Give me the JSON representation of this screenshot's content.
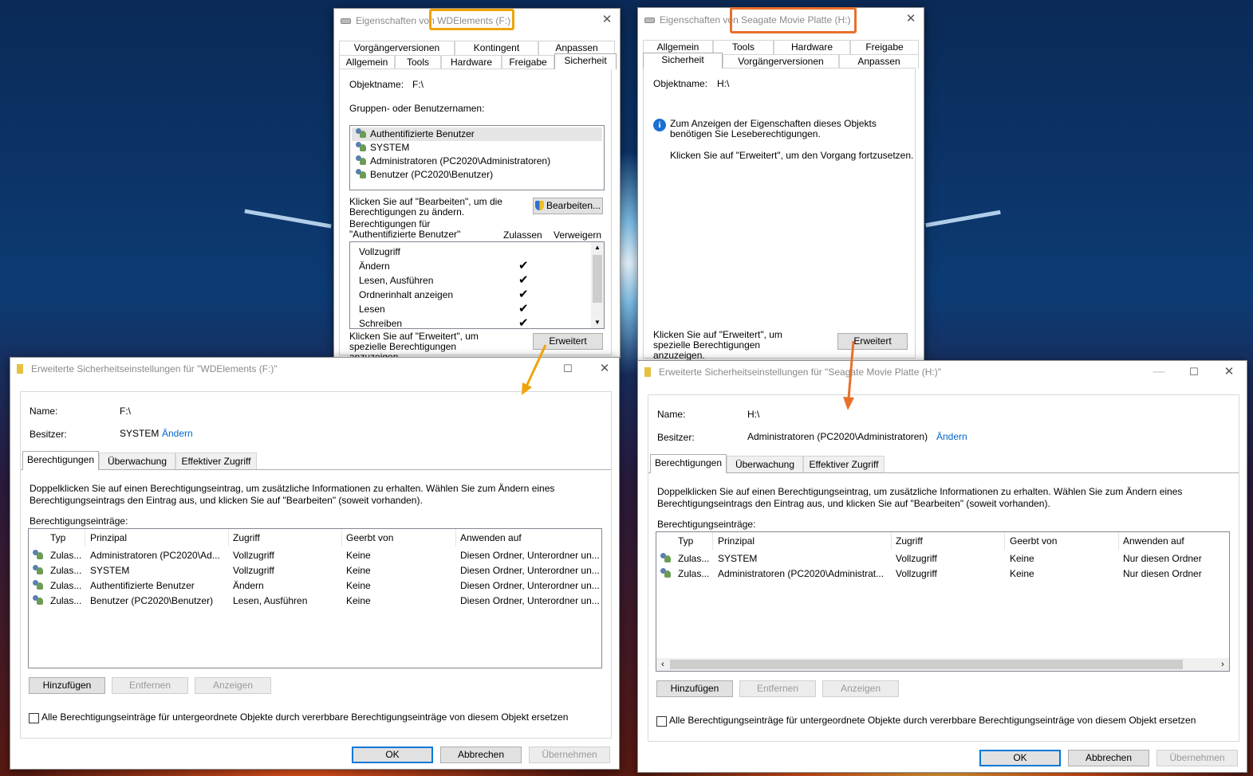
{
  "colors": {
    "highlight_left": "#f0a30a",
    "highlight_right": "#e8702a",
    "link": "#0066cc",
    "focus": "#0078d7"
  },
  "props_left": {
    "title": "Eigenschaften von WDElements (F:)",
    "tabs_row1": [
      "Vorgängerversionen",
      "Kontingent",
      "Anpassen"
    ],
    "tabs_row2": [
      "Allgemein",
      "Tools",
      "Hardware",
      "Freigabe",
      "Sicherheit"
    ],
    "object_label": "Objektname:",
    "object_value": "F:\\",
    "groups_label": "Gruppen- oder Benutzernamen:",
    "groups": [
      "Authentifizierte Benutzer",
      "SYSTEM",
      "Administratoren (PC2020\\Administratoren)",
      "Benutzer (PC2020\\Benutzer)"
    ],
    "edit_hint": "Klicken Sie auf \"Bearbeiten\", um die Berechtigungen zu ändern.",
    "edit_button": "Bearbeiten...",
    "perm_for": "Berechtigungen für \"Authentifizierte Benutzer\"",
    "col_allow": "Zulassen",
    "col_deny": "Verweigern",
    "perms": [
      "Vollzugriff",
      "Ändern",
      "Lesen, Ausführen",
      "Ordnerinhalt anzeigen",
      "Lesen",
      "Schreiben"
    ],
    "perm_allowed": [
      false,
      true,
      true,
      true,
      true,
      true
    ],
    "adv_hint": "Klicken Sie auf \"Erweitert\", um spezielle Berechtigungen anzuzeigen.",
    "adv_button": "Erweitert"
  },
  "props_right": {
    "title": "Eigenschaften von Seagate Movie Platte (H:)",
    "tabs_row1": [
      "Allgemein",
      "Tools",
      "Hardware",
      "Freigabe"
    ],
    "tabs_row2": [
      "Sicherheit",
      "Vorgängerversionen",
      "Anpassen"
    ],
    "object_label": "Objektname:",
    "object_value": "H:\\",
    "info1": "Zum Anzeigen der Eigenschaften dieses Objekts benötigen Sie Leseberechtigungen.",
    "info2": "Klicken Sie auf \"Erweitert\", um den Vorgang fortzusetzen.",
    "adv_hint": "Klicken Sie auf \"Erweitert\", um spezielle Berechtigungen anzuzeigen.",
    "adv_button": "Erweitert"
  },
  "adv_left": {
    "title": "Erweiterte Sicherheitseinstellungen für \"WDElements (F:)\"",
    "name_label": "Name:",
    "name_value": "F:\\",
    "owner_label": "Besitzer:",
    "owner_value": "SYSTEM",
    "change_link": "Ändern",
    "tabs": [
      "Berechtigungen",
      "Überwachung",
      "Effektiver Zugriff"
    ],
    "info": "Doppelklicken Sie auf einen Berechtigungseintrag, um zusätzliche Informationen zu erhalten. Wählen Sie zum Ändern eines Berechtigungseintrags den Eintrag aus, und klicken Sie auf \"Bearbeiten\" (soweit vorhanden).",
    "entries_label": "Berechtigungseinträge:",
    "columns": [
      "Typ",
      "Prinzipal",
      "Zugriff",
      "Geerbt von",
      "Anwenden auf"
    ],
    "rows": [
      [
        "Zulas...",
        "Administratoren (PC2020\\Ad...",
        "Vollzugriff",
        "Keine",
        "Diesen Ordner, Unterordner un..."
      ],
      [
        "Zulas...",
        "SYSTEM",
        "Vollzugriff",
        "Keine",
        "Diesen Ordner, Unterordner un..."
      ],
      [
        "Zulas...",
        "Authentifizierte Benutzer",
        "Ändern",
        "Keine",
        "Diesen Ordner, Unterordner un..."
      ],
      [
        "Zulas...",
        "Benutzer (PC2020\\Benutzer)",
        "Lesen, Ausführen",
        "Keine",
        "Diesen Ordner, Unterordner un..."
      ]
    ],
    "btn_add": "Hinzufügen",
    "btn_remove": "Entfernen",
    "btn_view": "Anzeigen",
    "replace_label": "Alle Berechtigungseinträge für untergeordnete Objekte durch vererbbare Berechtigungseinträge von diesem Objekt ersetzen",
    "ok": "OK",
    "cancel": "Abbrechen",
    "apply": "Übernehmen"
  },
  "adv_right": {
    "title": "Erweiterte Sicherheitseinstellungen für \"Seagate Movie Platte (H:)\"",
    "name_label": "Name:",
    "name_value": "H:\\",
    "owner_label": "Besitzer:",
    "owner_value": "Administratoren (PC2020\\Administratoren)",
    "change_link": "Ändern",
    "tabs": [
      "Berechtigungen",
      "Überwachung",
      "Effektiver Zugriff"
    ],
    "info": "Doppelklicken Sie auf einen Berechtigungseintrag, um zusätzliche Informationen zu erhalten. Wählen Sie zum Ändern eines Berechtigungseintrags den Eintrag aus, und klicken Sie auf \"Bearbeiten\" (soweit vorhanden).",
    "entries_label": "Berechtigungseinträge:",
    "columns": [
      "Typ",
      "Prinzipal",
      "Zugriff",
      "Geerbt von",
      "Anwenden auf"
    ],
    "rows": [
      [
        "Zulas...",
        "SYSTEM",
        "Vollzugriff",
        "Keine",
        "Nur diesen Ordner"
      ],
      [
        "Zulas...",
        "Administratoren (PC2020\\Administrat...",
        "Vollzugriff",
        "Keine",
        "Nur diesen Ordner"
      ]
    ],
    "btn_add": "Hinzufügen",
    "btn_remove": "Entfernen",
    "btn_view": "Anzeigen",
    "replace_label": "Alle Berechtigungseinträge für untergeordnete Objekte durch vererbbare Berechtigungseinträge von diesem Objekt ersetzen",
    "ok": "OK",
    "cancel": "Abbrechen",
    "apply": "Übernehmen"
  }
}
